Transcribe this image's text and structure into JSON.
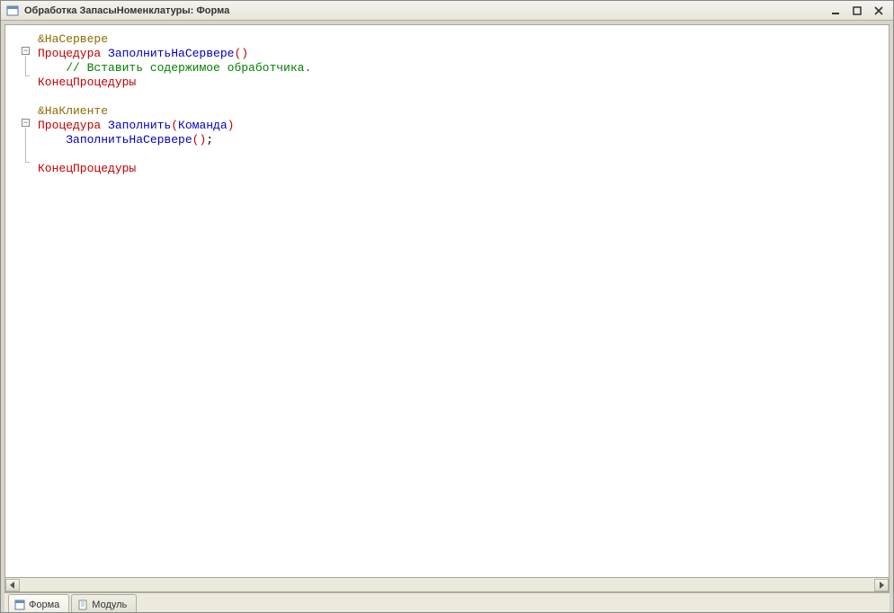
{
  "window": {
    "title": "Обработка ЗапасыНоменклатуры: Форма"
  },
  "code": {
    "line1_directive": "&НаСервере",
    "line2_kw": "Процедура",
    "line2_ident": " ЗаполнитьНаСервере",
    "line2_parens": "()",
    "line3_comment": "// Вставить содержимое обработчика.",
    "line4_kw": "КонецПроцедуры",
    "line6_directive": "&НаКлиенте",
    "line7_kw": "Процедура",
    "line7_ident": " Заполнить",
    "line7_paren_open": "(",
    "line7_param": "Команда",
    "line7_paren_close": ")",
    "line8_call": "ЗаполнитьНаСервере",
    "line8_parens": "()",
    "line8_semi": ";",
    "line10_kw": "КонецПроцедуры"
  },
  "tabs": {
    "form": "Форма",
    "module": "Модуль"
  }
}
